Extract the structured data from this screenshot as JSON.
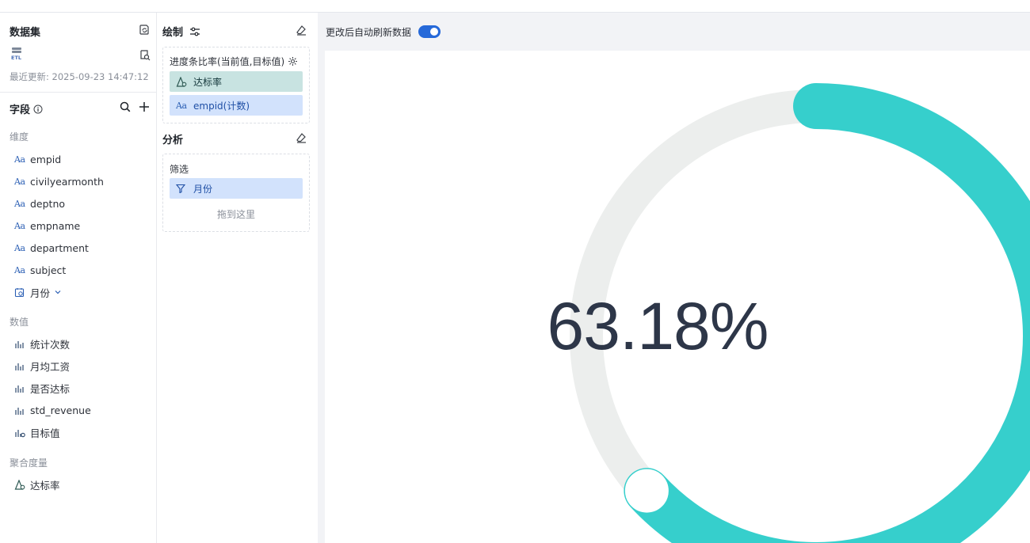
{
  "dataset": {
    "title": "数据集",
    "etl_badge": "ETL",
    "last_updated": "最近更新: 2025-09-23 14:47:12"
  },
  "fields": {
    "title": "字段",
    "dimension_group": "维度",
    "dimensions": [
      "empid",
      "civilyearmonth",
      "deptno",
      "empname",
      "department",
      "subject"
    ],
    "date_field": "月份",
    "measure_group": "数值",
    "measures": [
      "统计次数",
      "月均工资",
      "是否达标",
      "std_revenue",
      "目标值"
    ],
    "aggregate_group": "聚合度量",
    "aggregates": [
      "达标率"
    ]
  },
  "draw": {
    "title": "绘制",
    "chart_box_title": "进度条比率(当前值,目标值)",
    "current_value_pill": "达标率",
    "target_value_pill": "empid(计数)"
  },
  "analysis": {
    "title": "分析",
    "filter_label": "筛选",
    "filter_pill": "月份",
    "drop_hint": "拖到这里"
  },
  "preview": {
    "auto_refresh_label": "更改后自动刷新数据",
    "auto_refresh_on": true
  },
  "colors": {
    "progress": "#36cfcc",
    "track": "#eceeed",
    "accent": "#2669d9"
  },
  "chart_data": {
    "type": "gauge",
    "value": 0.6318,
    "label": "63.18%"
  }
}
